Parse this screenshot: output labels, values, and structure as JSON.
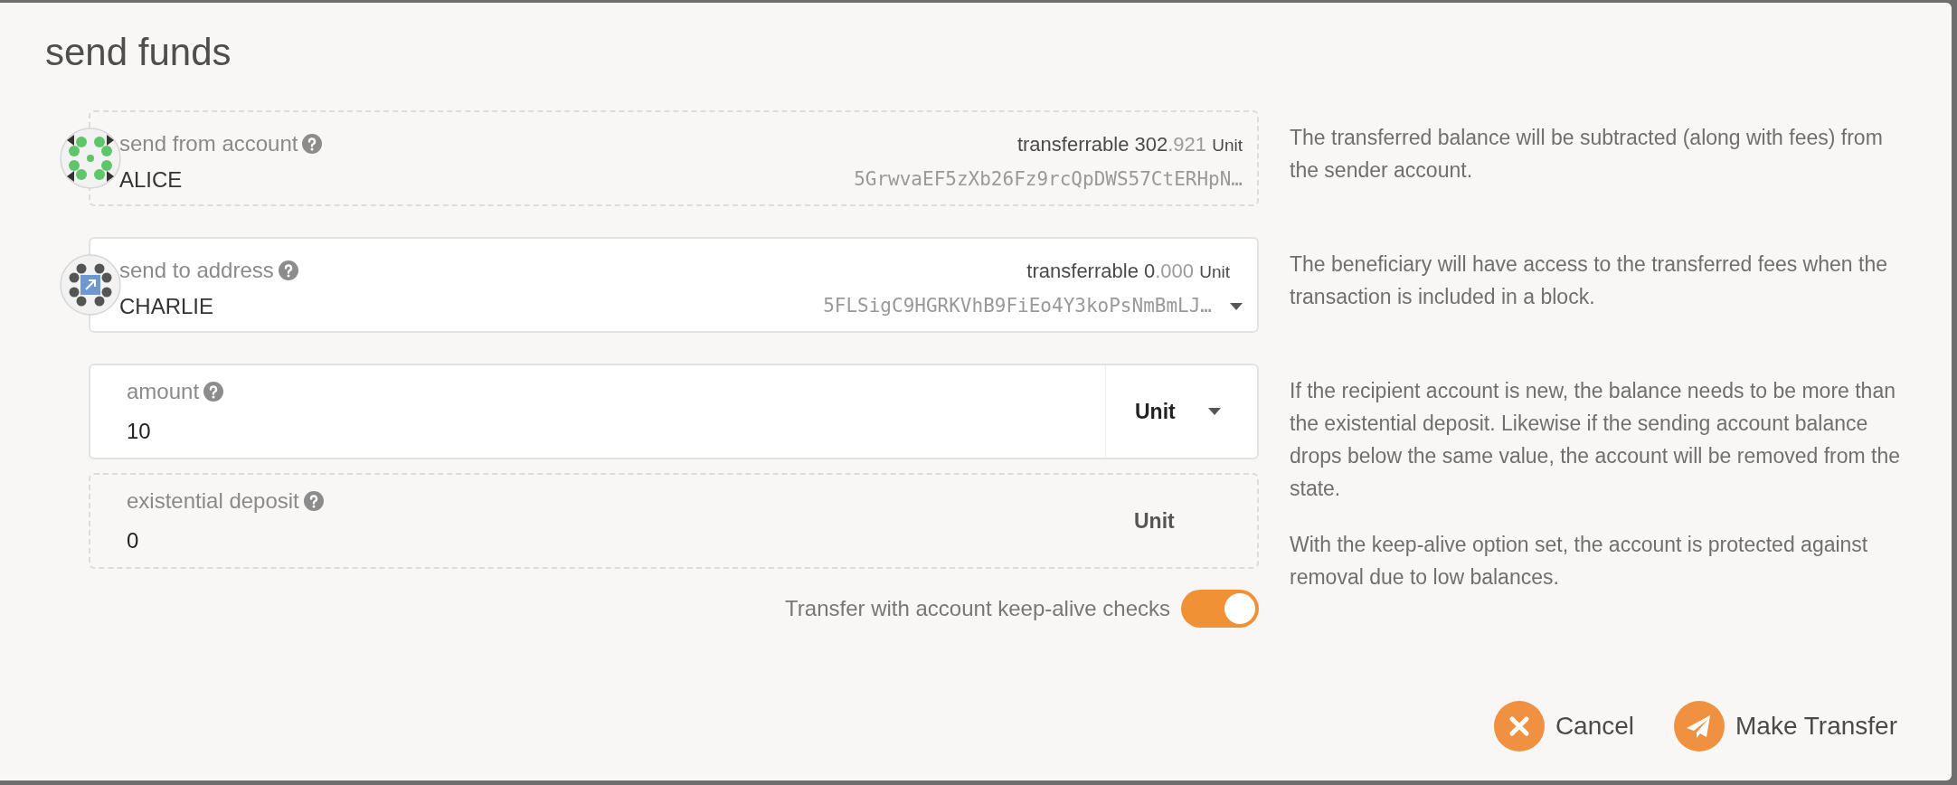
{
  "title": "send funds",
  "sections": [
    {
      "fields": [
        {
          "kind": "account",
          "label": "send from account",
          "balance_label": "transferrable",
          "balance_int": "302",
          "balance_dec": ".921",
          "balance_unit": "Unit",
          "name": "ALICE",
          "address": "5GrwvaEF5zXb26Fz9rcQpDWS57CtERHpN…",
          "disabled": true,
          "dropdown": false
        }
      ],
      "help": [
        "The transferred balance will be subtracted (along with fees) from the sender account."
      ]
    },
    {
      "fields": [
        {
          "kind": "account",
          "label": "send to address",
          "balance_label": "transferrable",
          "balance_int": "0",
          "balance_dec": ".000",
          "balance_unit": "Unit",
          "name": "CHARLIE",
          "address": "5FLSigC9HGRKVhB9FiEo4Y3koPsNmBmLJ…",
          "disabled": false,
          "dropdown": true
        }
      ],
      "help": [
        "The beneficiary will have access to the transferred fees when the transaction is included in a block."
      ]
    },
    {
      "fields": [
        {
          "kind": "amount",
          "label": "amount",
          "value": "10",
          "unit": "Unit",
          "disabled": false,
          "dropdown": true
        },
        {
          "kind": "amount",
          "label": "existential deposit",
          "value": "0",
          "unit": "Unit",
          "disabled": true,
          "dropdown": false
        }
      ],
      "toggle": {
        "label": "Transfer with account keep-alive checks",
        "on": true
      },
      "help": [
        "If the recipient account is new, the balance needs to be more than the existential deposit. Likewise if the sending account balance drops below the same value, the account will be removed from the state.",
        "With the keep-alive option set, the account is protected against removal due to low balances."
      ]
    }
  ],
  "buttons": [
    {
      "kind": "cancel",
      "label": "Cancel"
    },
    {
      "kind": "send",
      "label": "Make Transfer"
    }
  ]
}
